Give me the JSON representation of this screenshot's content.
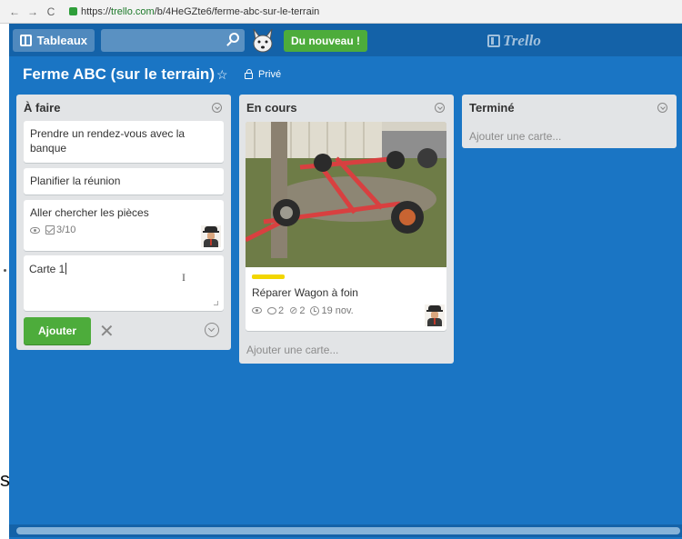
{
  "browser": {
    "url_scheme": "https://",
    "url_host": "trello.com",
    "url_path": "/b/4HeGZte6/ferme-abc-sur-le-terrain"
  },
  "header": {
    "boards_label": "Tableaux",
    "new_label": "Du nouveau !",
    "logo_label": "Trello"
  },
  "board": {
    "title": "Ferme ABC (sur le terrain)",
    "visibility": "Privé"
  },
  "lists": [
    {
      "title": "À faire",
      "cards": [
        {
          "text": "Prendre un rendez-vous avec la banque"
        },
        {
          "text": "Planifier la réunion"
        },
        {
          "text": "Aller chercher les pièces",
          "checklist": "3/10"
        }
      ],
      "composer_text": "Carte 1",
      "add_button": "Ajouter"
    },
    {
      "title": "En cours",
      "cards": [
        {
          "text": "Réparer Wagon à foin",
          "comments": "2",
          "attachments": "2",
          "due": "19 nov."
        }
      ],
      "add_card": "Ajouter une carte..."
    },
    {
      "title": "Terminé",
      "add_card": "Ajouter une carte..."
    }
  ],
  "overlay": {
    "stray_char": "s"
  },
  "colors": {
    "board_bg": "#1a75c4",
    "header_bg": "#1462a8",
    "accent_green": "#4dac3b",
    "label_yellow": "#f2d600"
  }
}
